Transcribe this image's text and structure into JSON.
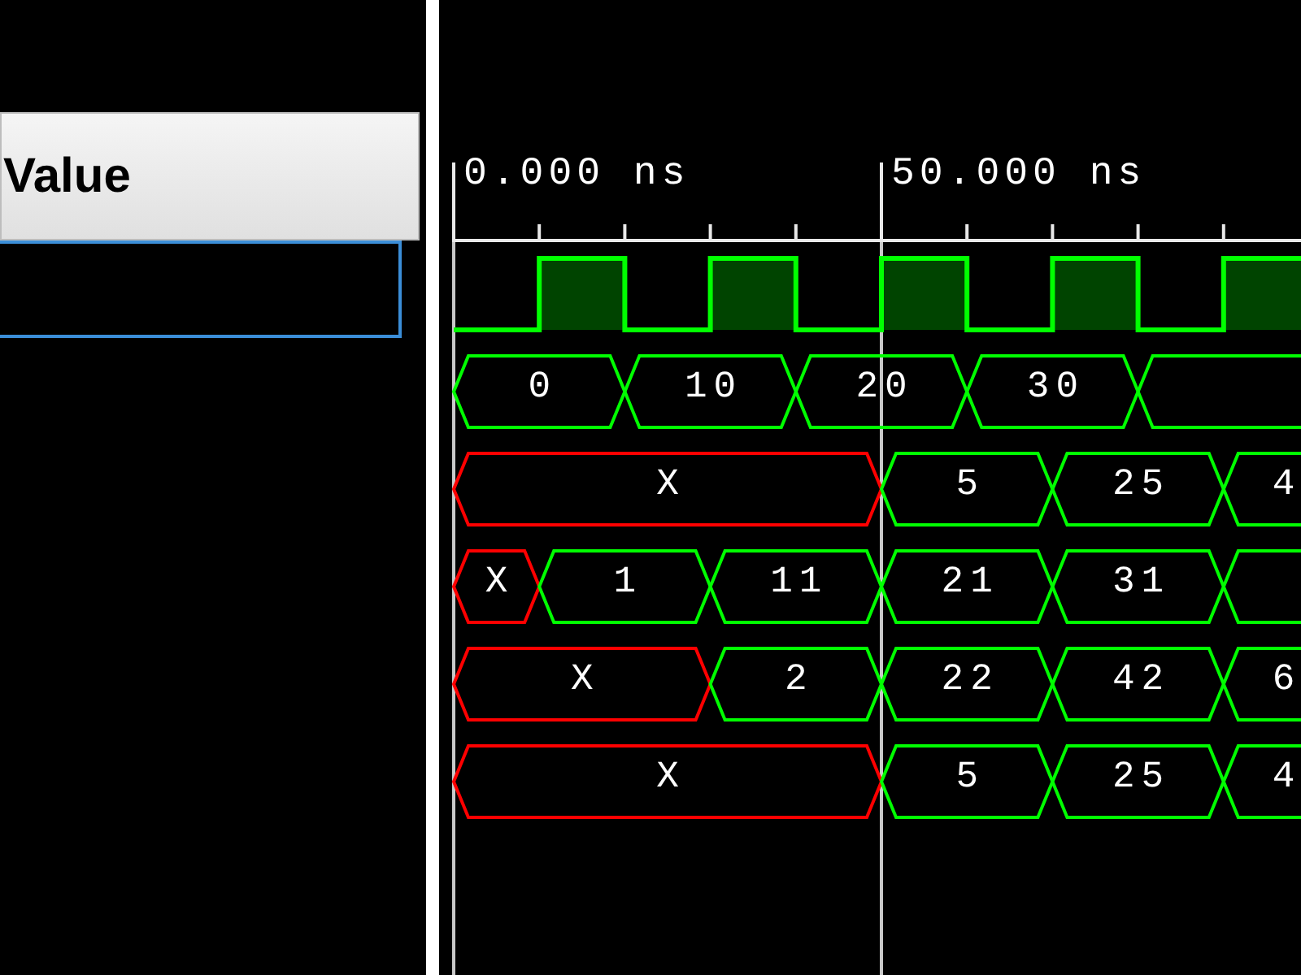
{
  "panel": {
    "column_header": "Value"
  },
  "ruler": {
    "labels": [
      "0.000 ns",
      "50.000 ns"
    ]
  },
  "signals": [
    {
      "kind": "clock",
      "selected": true
    },
    {
      "kind": "bus",
      "selected": false,
      "segments": [
        {
          "kind": "known",
          "value": "0"
        },
        {
          "kind": "known",
          "value": "10"
        },
        {
          "kind": "known",
          "value": "20"
        },
        {
          "kind": "known",
          "value": "30"
        },
        {
          "kind": "known"
        }
      ]
    },
    {
      "kind": "bus",
      "selected": false,
      "segments": [
        {
          "kind": "unknown",
          "value": "X"
        },
        {
          "kind": "known",
          "value": "5"
        },
        {
          "kind": "known",
          "value": "25"
        },
        {
          "kind": "known",
          "value": "4"
        }
      ]
    },
    {
      "kind": "bus",
      "selected": false,
      "segments": [
        {
          "kind": "unknown",
          "value": "X"
        },
        {
          "kind": "known",
          "value": "1"
        },
        {
          "kind": "known",
          "value": "11"
        },
        {
          "kind": "known",
          "value": "21"
        },
        {
          "kind": "known",
          "value": "31"
        },
        {
          "kind": "known"
        }
      ]
    },
    {
      "kind": "bus",
      "selected": false,
      "segments": [
        {
          "kind": "unknown",
          "value": "X"
        },
        {
          "kind": "known",
          "value": "2"
        },
        {
          "kind": "known",
          "value": "22"
        },
        {
          "kind": "known",
          "value": "42"
        },
        {
          "kind": "known",
          "value": "6"
        }
      ]
    },
    {
      "kind": "bus",
      "selected": false,
      "segments": [
        {
          "kind": "unknown",
          "value": "X"
        },
        {
          "kind": "known",
          "value": "5"
        },
        {
          "kind": "known",
          "value": "25"
        },
        {
          "kind": "known",
          "value": "4"
        }
      ]
    }
  ]
}
